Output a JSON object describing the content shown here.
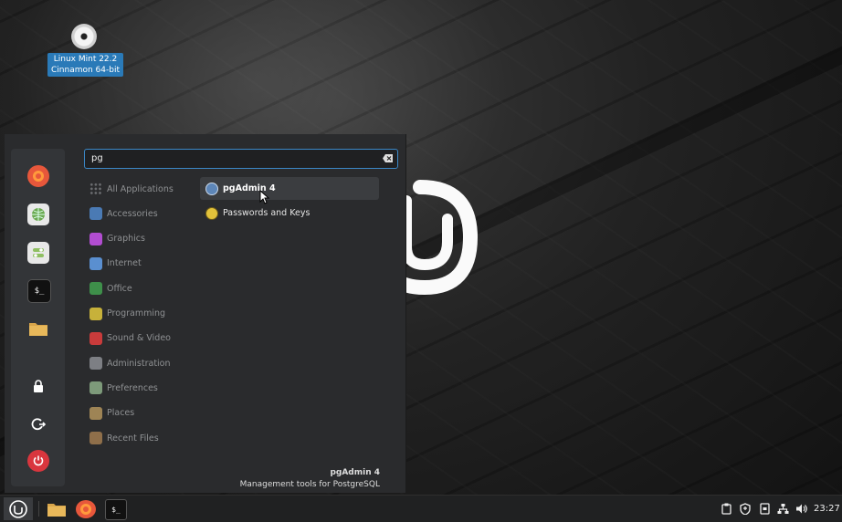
{
  "desktop": {
    "icon_label": "Linux Mint 22.2\nCinnamon 64-bit"
  },
  "menu": {
    "search": {
      "value": "pg"
    },
    "sidebar": [
      {
        "icon": "firefox-icon",
        "color": "#e7573b"
      },
      {
        "icon": "software-manager-icon",
        "color": "#6aa84f"
      },
      {
        "icon": "settings-toggle-icon",
        "color": "#8fbf62"
      },
      {
        "icon": "terminal-icon",
        "color": "#1a1a1a"
      },
      {
        "icon": "folder-icon",
        "color": "#d8a54a"
      },
      {
        "icon": "lock-icon",
        "color": "#1c1c1c"
      },
      {
        "icon": "logout-icon",
        "color": "#1c1c1c"
      },
      {
        "icon": "power-icon",
        "color": "#d9363e"
      }
    ],
    "categories": [
      {
        "label": "All Applications",
        "color": "#5a5c60"
      },
      {
        "label": "Accessories",
        "color": "#4a7ab4"
      },
      {
        "label": "Graphics",
        "color": "#b24dd1"
      },
      {
        "label": "Internet",
        "color": "#5a8fd0"
      },
      {
        "label": "Office",
        "color": "#3e8f4a"
      },
      {
        "label": "Programming",
        "color": "#c7b13a"
      },
      {
        "label": "Sound & Video",
        "color": "#c93b3b"
      },
      {
        "label": "Administration",
        "color": "#7d7f84"
      },
      {
        "label": "Preferences",
        "color": "#7d9a7a"
      },
      {
        "label": "Places",
        "color": "#9e8455"
      },
      {
        "label": "Recent Files",
        "color": "#8f6f4a"
      }
    ],
    "results": [
      {
        "label": "pgAdmin 4",
        "icon": "pgadmin-elephant-icon",
        "active": true
      },
      {
        "label": "Passwords and Keys",
        "icon": "passwords-keys-icon",
        "active": false
      }
    ],
    "description": {
      "title": "pgAdmin 4",
      "text": "Management tools for PostgreSQL"
    }
  },
  "taskbar": {
    "clock": "23:27",
    "launchers": [
      "files-folder-icon",
      "firefox-icon",
      "terminal-icon"
    ],
    "tray_icons": [
      "clipboard-icon",
      "shield-update-icon",
      "notes-icon",
      "network-icon",
      "volume-icon"
    ]
  },
  "colors": {
    "accent": "#3b87c6",
    "menu_bg": "#2a2b2d",
    "taskbar_bg": "#202122"
  }
}
